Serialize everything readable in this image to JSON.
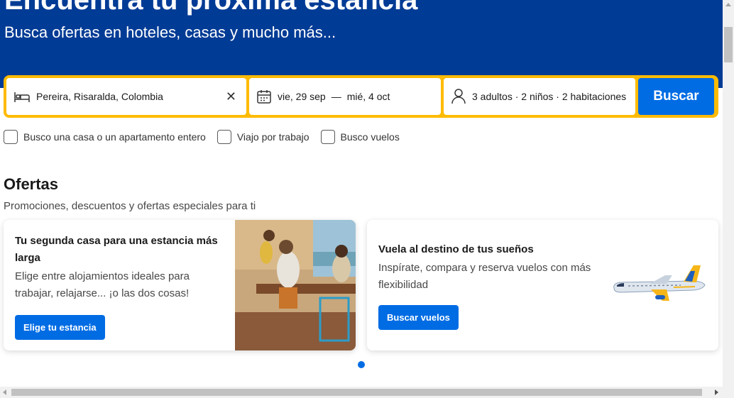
{
  "hero": {
    "title": "Encuentra tu próxima estancia",
    "subtitle": "Busca ofertas en hoteles, casas y mucho más..."
  },
  "search": {
    "destination": "Pereira, Risaralda, Colombia",
    "checkin": "vie, 29 sep",
    "separator": "—",
    "checkout": "mié, 4 oct",
    "guests": "3 adultos · 2 niños · 2 habitaciones",
    "button": "Buscar",
    "icons": [
      "bed-icon",
      "calendar-icon",
      "person-icon",
      "close-icon",
      "chevron-down-icon"
    ]
  },
  "filters": [
    {
      "label": "Busco una casa o un apartamento entero",
      "checked": false
    },
    {
      "label": "Viajo por trabajo",
      "checked": false
    },
    {
      "label": "Busco vuelos",
      "checked": false
    }
  ],
  "ofertas": {
    "title": "Ofertas",
    "subtitle": "Promociones, descuentos y ofertas especiales para ti",
    "cards": [
      {
        "title": "Tu segunda casa para una estancia más larga",
        "text": "Elige entre alojamientos ideales para trabajar, relajarse... ¡o las dos cosas!",
        "button": "Elige tu estancia"
      },
      {
        "title": "Vuela al destino de tus sueños",
        "text": "Inspírate, compara y reserva vuelos con más flexibilidad",
        "button": "Buscar vuelos"
      }
    ]
  },
  "colors": {
    "brand_blue": "#003b95",
    "accent_yellow": "#febb02",
    "button_blue": "#006ce4"
  }
}
